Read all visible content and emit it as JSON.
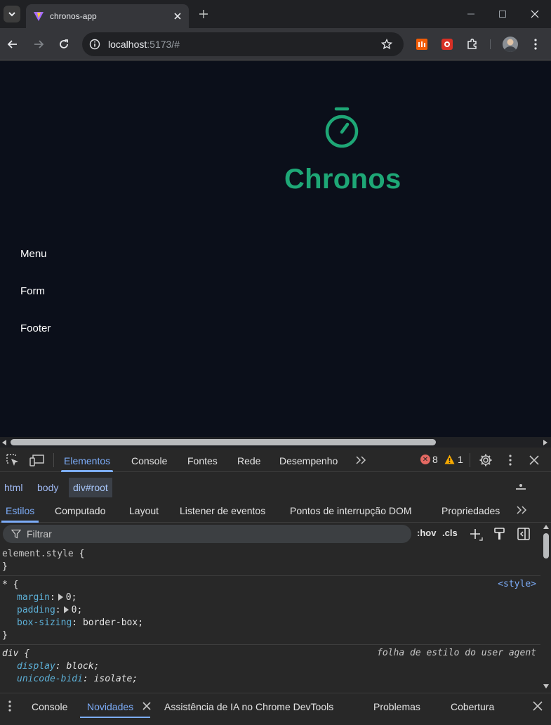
{
  "browser": {
    "tab_title": "chronos-app",
    "url_host": "localhost",
    "url_rest": ":5173/#"
  },
  "page": {
    "brand_title": "Chronos",
    "brand_color": "#1ea776",
    "links": [
      "Menu",
      "Form",
      "Footer"
    ]
  },
  "devtools": {
    "main_tabs": [
      "Elementos",
      "Console",
      "Fontes",
      "Rede",
      "Desempenho"
    ],
    "error_count": "8",
    "warning_count": "1",
    "breadcrumbs": [
      "html",
      "body",
      "div#root"
    ],
    "sub_tabs": [
      "Estilos",
      "Computado",
      "Layout",
      "Listener de eventos",
      "Pontos de interrupção DOM",
      "Propriedades"
    ],
    "filter_placeholder": "Filtrar",
    "filter_tools": [
      ":hov",
      ".cls"
    ],
    "rules": {
      "element_style": "element.style",
      "universal_selector": "*",
      "universal_source": "<style>",
      "universal_props": [
        {
          "name": "margin",
          "value": "0"
        },
        {
          "name": "padding",
          "value": "0"
        },
        {
          "name": "box-sizing",
          "value": "border-box"
        }
      ],
      "div_selector": "div",
      "div_source": "folha de estilo do user agent",
      "div_props": [
        {
          "name": "display",
          "value": "block"
        },
        {
          "name": "unicode-bidi",
          "value": "isolate"
        }
      ]
    },
    "drawer_tabs": [
      "Console",
      "Novidades",
      "Assistência de IA no Chrome DevTools",
      "Problemas",
      "Cobertura"
    ]
  }
}
